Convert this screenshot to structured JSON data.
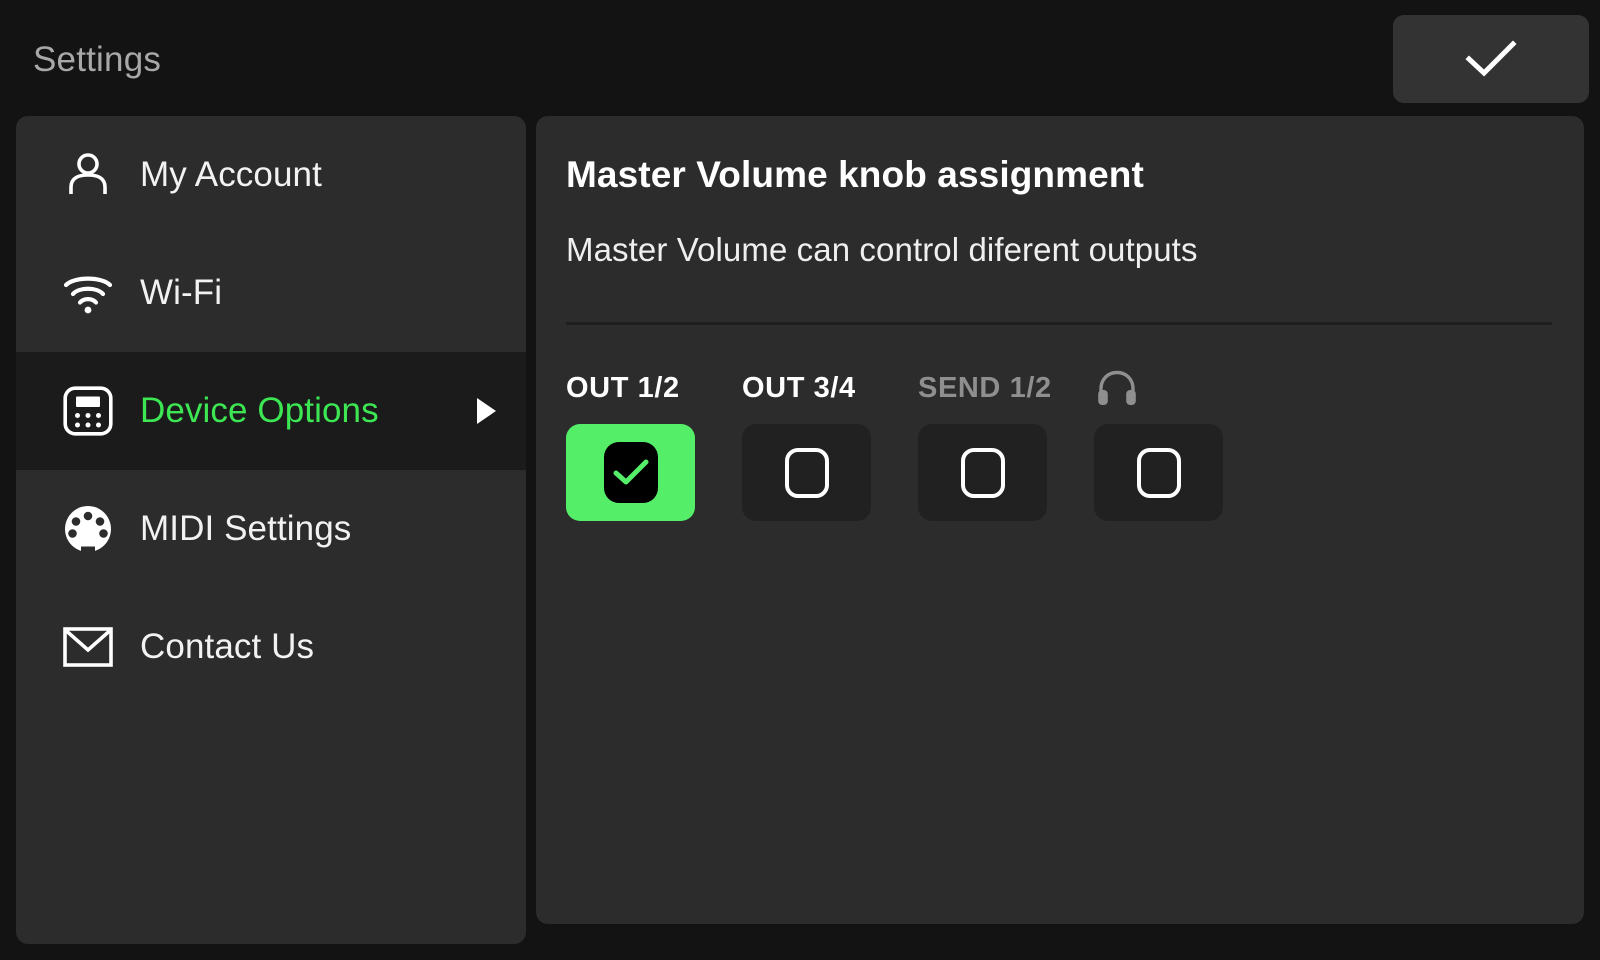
{
  "topbar": {
    "title": "Settings",
    "confirm_icon": "check-icon"
  },
  "sidebar": {
    "items": [
      {
        "label": "My Account",
        "icon": "person-icon",
        "selected": false,
        "has_caret": false
      },
      {
        "label": "Wi-Fi",
        "icon": "wifi-icon",
        "selected": false,
        "has_caret": false
      },
      {
        "label": "Device Options",
        "icon": "device-icon",
        "selected": true,
        "has_caret": true
      },
      {
        "label": "MIDI Settings",
        "icon": "midi-din-icon",
        "selected": false,
        "has_caret": false
      },
      {
        "label": "Contact Us",
        "icon": "envelope-icon",
        "selected": false,
        "has_caret": false
      }
    ]
  },
  "panel": {
    "title": "Master Volume knob assignment",
    "subtitle": "Master Volume can control diferent outputs",
    "options": [
      {
        "label": "OUT 1/2",
        "icon": null,
        "dimmed": false,
        "checked": true
      },
      {
        "label": "OUT 3/4",
        "icon": null,
        "dimmed": false,
        "checked": false
      },
      {
        "label": "SEND 1/2",
        "icon": null,
        "dimmed": true,
        "checked": false
      },
      {
        "label": "",
        "icon": "headphone-icon",
        "dimmed": true,
        "checked": false
      }
    ]
  },
  "colors": {
    "accent_green": "#3ce753",
    "tile_green": "#54ee69",
    "page_bg": "#131313",
    "panel_bg": "#2c2c2c",
    "selected_row_bg": "#1b1b1b",
    "tile_bg": "#212121"
  }
}
